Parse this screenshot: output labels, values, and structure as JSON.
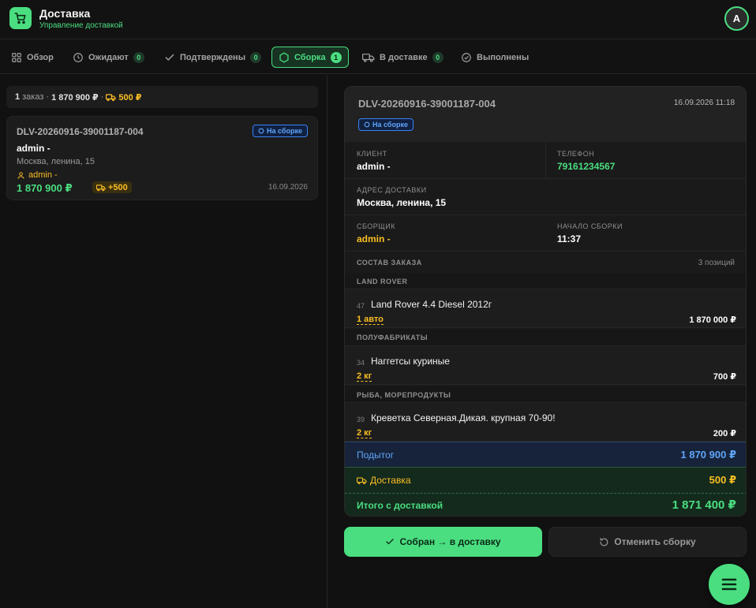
{
  "app": {
    "title": "Доставка",
    "subtitle": "Управление доставкой",
    "avatar_initial": "A"
  },
  "tabs": [
    {
      "label": "Обзор",
      "icon": "grid-icon",
      "count": null,
      "active": false
    },
    {
      "label": "Ожидают",
      "icon": "clock-icon",
      "count": "0",
      "active": false
    },
    {
      "label": "Подтверждены",
      "icon": "check-icon",
      "count": "0",
      "active": false
    },
    {
      "label": "Сборка",
      "icon": "hexagon-icon",
      "count": "1",
      "active": true
    },
    {
      "label": "В доставке",
      "icon": "truck-icon",
      "count": "0",
      "active": false
    },
    {
      "label": "Выполнены",
      "icon": "check-circle-icon",
      "count": null,
      "active": false
    }
  ],
  "summary": {
    "count": "1",
    "count_suffix": "заказ",
    "sep1": "·",
    "total": "1 870 900 ₽",
    "sep2": "·",
    "delivery": "500 ₽"
  },
  "order_card": {
    "id": "DLV-20260916-39001187-004",
    "status": "На сборке",
    "customer": "admin -",
    "address": "Москва, ленина, 15",
    "assembler": "admin -",
    "total": "1 870 900 ₽",
    "delivery_pill": "+500",
    "date": "16.09.2026"
  },
  "detail": {
    "id": "DLV-20260916-39001187-004",
    "datetime": "16.09.2026 11:18",
    "status": "На сборке",
    "client_label": "КЛИЕНТ",
    "client": "admin -",
    "phone_label": "ТЕЛЕФОН",
    "phone": "79161234567",
    "address_label": "АДРЕС ДОСТАВКИ",
    "address": "Москва, ленина, 15",
    "assembler_label": "СБОРЩИК",
    "assembler": "admin -",
    "start_label": "НАЧАЛО СБОРКИ",
    "start": "11:37",
    "composition_label": "СОСТАВ ЗАКАЗА",
    "positions": "3 позиций",
    "categories": [
      {
        "name": "LAND ROVER",
        "item": {
          "num": "47",
          "name": "Land Rover 4.4 Diesel 2012г",
          "qty": "1 авто",
          "price": "1 870 000 ₽"
        }
      },
      {
        "name": "ПОЛУФАБРИКАТЫ",
        "item": {
          "num": "34",
          "name": "Наггетсы куриные",
          "qty": "2 кг",
          "price": "700 ₽"
        }
      },
      {
        "name": "РЫБА, МОРЕПРОДУКТЫ",
        "item": {
          "num": "39",
          "name": "Креветка Северная.Дикая. крупная 70-90!",
          "qty": "2 кг",
          "price": "200 ₽"
        }
      }
    ],
    "subtotal_label": "Подытог",
    "subtotal": "1 870 900 ₽",
    "delivery_label": "Доставка",
    "delivery": "500 ₽",
    "grand_label": "Итого с доставкой",
    "grand": "1 871 400 ₽"
  },
  "actions": {
    "primary": "Собран → в доставку",
    "secondary": "Отменить сборку"
  },
  "colors": {
    "accent": "#4ade80",
    "warning": "#fbbf24",
    "info": "#60a5fa",
    "background": "#111111"
  }
}
